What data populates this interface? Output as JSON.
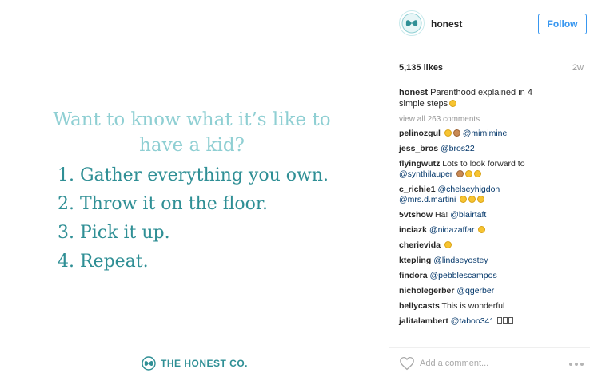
{
  "post": {
    "headline": "Want to know what it’s like to have a kid?",
    "steps": [
      "1. Gather everything you own.",
      "2. Throw it on the floor.",
      "3. Pick it up.",
      "4. Repeat."
    ],
    "brand": "THE HONEST CO."
  },
  "header": {
    "username": "honest",
    "follow_label": "Follow"
  },
  "stats": {
    "likes": "5,135 likes",
    "time": "2w"
  },
  "caption": {
    "user": "honest",
    "text": "Parenthood explained in 4 simple steps"
  },
  "view_all": "view all 263 comments",
  "comments": [
    {
      "user": "pelinozgul",
      "text": "@mimimine"
    },
    {
      "user": "jess_bros",
      "text": "@bros22"
    },
    {
      "user": "flyingwutz",
      "text": "Lots to look forward to",
      "text2": "@synthilauper"
    },
    {
      "user": "c_richie1",
      "text": "@chelseyhigdon",
      "text2": "@mrs.d.martini"
    },
    {
      "user": "5vtshow",
      "text": "Ha!",
      "mention": "@blairtaft"
    },
    {
      "user": "inciazk",
      "text": "@nidazaffar"
    },
    {
      "user": "cherievida",
      "text": ""
    },
    {
      "user": "ktepling",
      "text": "@lindseyostey"
    },
    {
      "user": "findora",
      "text": "@pebblescampos"
    },
    {
      "user": "nicholegerber",
      "text": "@qgerber"
    },
    {
      "user": "bellycasts",
      "text": "This is wonderful"
    },
    {
      "user": "jalitalambert",
      "text": "@taboo341"
    }
  ],
  "footer": {
    "placeholder": "Add a comment..."
  },
  "colors": {
    "brand_teal": "#2f8f95",
    "light_teal": "#8fcfd3",
    "link_blue": "#3897f0"
  },
  "icons": [
    "honest-logo-icon",
    "heart-icon",
    "more-options-icon",
    "emoji-icon"
  ]
}
